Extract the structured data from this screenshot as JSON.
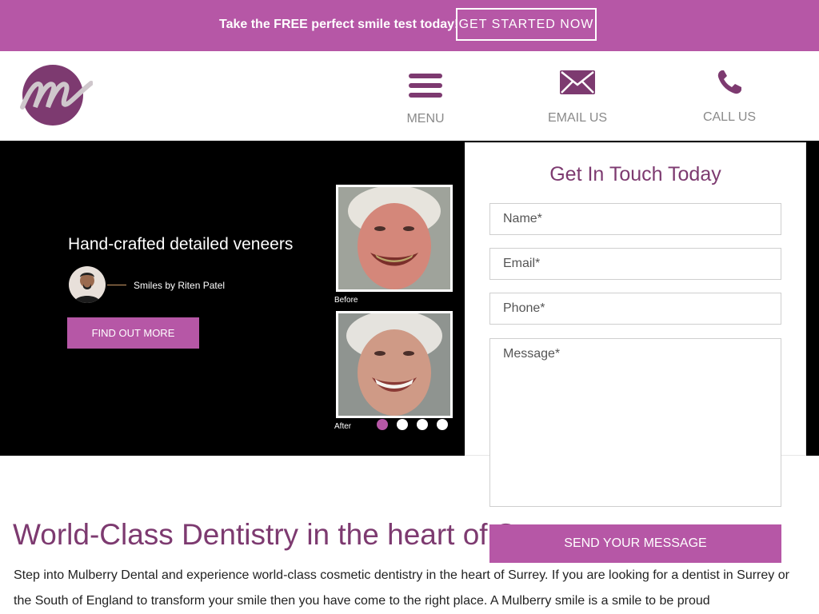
{
  "promo": {
    "text": "Take the FREE perfect smile test today!",
    "button": "GET STARTED NOW"
  },
  "nav": {
    "menu": "MENU",
    "email": "EMAIL US",
    "call": "CALL US"
  },
  "hero": {
    "title": "Hand-crafted detailed veneers",
    "byline": "Smiles by Riten Patel",
    "button": "FIND OUT MORE",
    "before_caption": "Before",
    "after_caption": "After",
    "slide_count": 4,
    "active_slide": 1
  },
  "form": {
    "title": "Get In Touch Today",
    "name_placeholder": "Name*",
    "email_placeholder": "Email*",
    "phone_placeholder": "Phone*",
    "message_placeholder": "Message*",
    "send_button": "SEND YOUR MESSAGE"
  },
  "main": {
    "title": "World-Class Dentistry in the heart of Surrey",
    "paragraph": "Step into Mulberry Dental and experience world-class cosmetic dentistry in the heart of Surrey. If you are looking for a dentist in Surrey or the South of England to transform your smile then you have come to the right place. A Mulberry smile is a smile to be proud"
  },
  "colors": {
    "brand_purple": "#b657a6",
    "dark_purple": "#7d3a70"
  },
  "icons": [
    "hamburger-menu-icon",
    "envelope-icon",
    "phone-icon"
  ]
}
